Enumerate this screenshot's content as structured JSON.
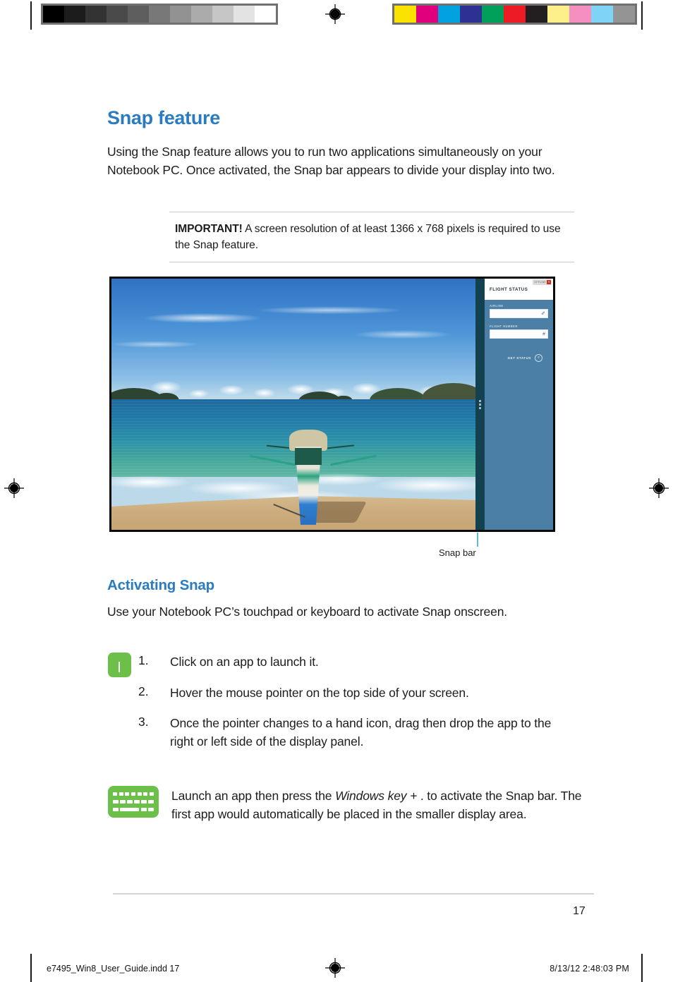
{
  "document": {
    "section_title": "Snap feature",
    "intro_paragraph": "Using the Snap feature allows you to run two applications simultaneously on your Notebook PC. Once activated, the Snap bar appears to divide your display into two.",
    "important_note": {
      "lead": "IMPORTANT!",
      "text": " A screen resolution of at least 1366 x 768 pixels is required to use the Snap feature."
    },
    "figure_caption": "Snap bar",
    "sub_title": "Activating Snap",
    "activate_paragraph": "Use your Notebook PC’s touchpad or keyboard to activate Snap onscreen.",
    "steps": [
      {
        "num": "1.",
        "text": "Click on an app to launch it."
      },
      {
        "num": "2.",
        "text": "Hover the mouse pointer on the top side of your screen."
      },
      {
        "num": "3.",
        "text": "Once the pointer changes to a hand icon, drag then drop the app to the right or left side of the display panel."
      }
    ],
    "keyboard_note": {
      "part1": "Launch an app then press the ",
      "emphasis": "Windows key + ",
      "part2": ". to activate the Snap bar. The first app would automatically be placed in the smaller display area."
    },
    "page_number": "17",
    "footer": {
      "file_name": "e7495_Win8_User_Guide.indd   17",
      "timestamp": "8/13/12   2:48:03 PM"
    }
  },
  "figure": {
    "wallpaper_description": "Tropical beach with outrigger boat on sand, islands on horizon",
    "app": {
      "title": "FLIGHT STATUS",
      "chrome_label": "OFFLINE",
      "close_label": "×",
      "fields": [
        {
          "label": "AIRLINE",
          "value": "",
          "icon": "pen-icon",
          "glyph": "✐"
        },
        {
          "label": "FLIGHT NUMBER",
          "value": "",
          "icon": "hash-icon",
          "glyph": "#"
        }
      ],
      "action": {
        "label": "GET STATUS",
        "icon": "search-icon",
        "glyph": "⌕"
      }
    },
    "snap_bar_color": "#14414f",
    "app_pane_color": "#4b7fa5"
  },
  "colors": {
    "heading_blue": "#2b7bc0",
    "icon_green": "#6cc04a",
    "leader_blue": "#63b8d8",
    "body_text": "#1c1c1c"
  },
  "print_marks": {
    "grayscale_wedge": [
      "#000000",
      "#1c1c1c",
      "#333333",
      "#4a4a4a",
      "#5e5e5e",
      "#787878",
      "#929292",
      "#ababab",
      "#c6c6c6",
      "#e3e3e3",
      "#ffffff"
    ],
    "color_wedge": [
      "#fce200",
      "#e0007d",
      "#00a3e0",
      "#2e3192",
      "#00a05a",
      "#ed1c24",
      "#231f20",
      "#fdf08a",
      "#f58fc2",
      "#7fd4f5",
      "#949494"
    ],
    "registration_icon": "registration-target-icon"
  }
}
